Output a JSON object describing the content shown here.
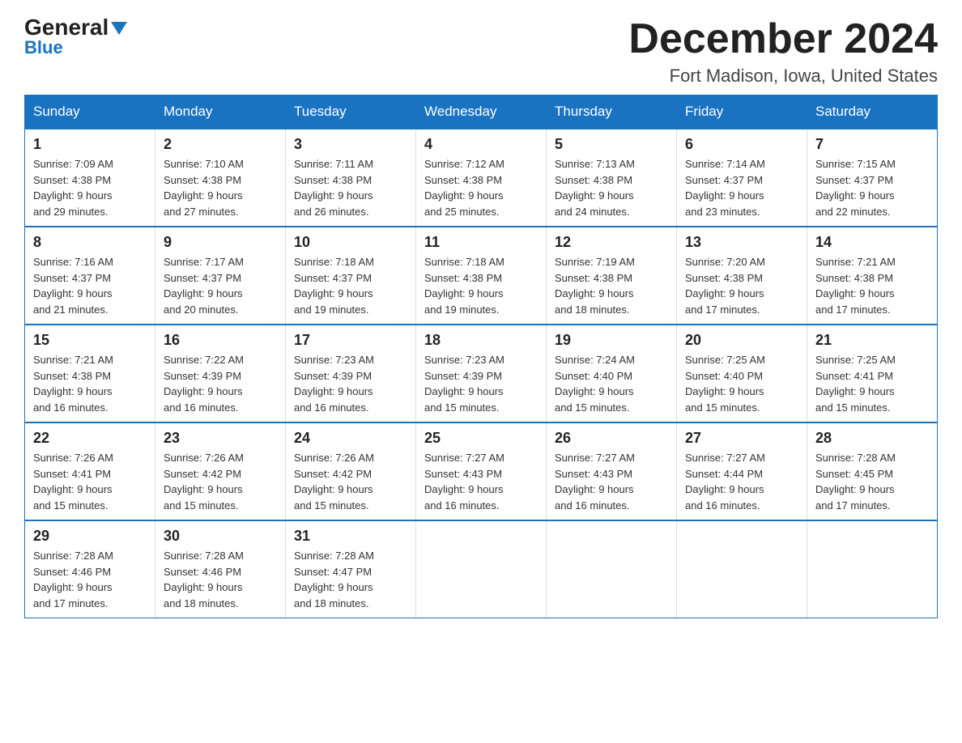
{
  "logo": {
    "general": "General",
    "blue": "Blue",
    "triangle": "▲"
  },
  "title": "December 2024",
  "location": "Fort Madison, Iowa, United States",
  "days_of_week": [
    "Sunday",
    "Monday",
    "Tuesday",
    "Wednesday",
    "Thursday",
    "Friday",
    "Saturday"
  ],
  "weeks": [
    [
      {
        "day": "1",
        "sunrise": "7:09 AM",
        "sunset": "4:38 PM",
        "daylight": "9 hours and 29 minutes."
      },
      {
        "day": "2",
        "sunrise": "7:10 AM",
        "sunset": "4:38 PM",
        "daylight": "9 hours and 27 minutes."
      },
      {
        "day": "3",
        "sunrise": "7:11 AM",
        "sunset": "4:38 PM",
        "daylight": "9 hours and 26 minutes."
      },
      {
        "day": "4",
        "sunrise": "7:12 AM",
        "sunset": "4:38 PM",
        "daylight": "9 hours and 25 minutes."
      },
      {
        "day": "5",
        "sunrise": "7:13 AM",
        "sunset": "4:38 PM",
        "daylight": "9 hours and 24 minutes."
      },
      {
        "day": "6",
        "sunrise": "7:14 AM",
        "sunset": "4:37 PM",
        "daylight": "9 hours and 23 minutes."
      },
      {
        "day": "7",
        "sunrise": "7:15 AM",
        "sunset": "4:37 PM",
        "daylight": "9 hours and 22 minutes."
      }
    ],
    [
      {
        "day": "8",
        "sunrise": "7:16 AM",
        "sunset": "4:37 PM",
        "daylight": "9 hours and 21 minutes."
      },
      {
        "day": "9",
        "sunrise": "7:17 AM",
        "sunset": "4:37 PM",
        "daylight": "9 hours and 20 minutes."
      },
      {
        "day": "10",
        "sunrise": "7:18 AM",
        "sunset": "4:37 PM",
        "daylight": "9 hours and 19 minutes."
      },
      {
        "day": "11",
        "sunrise": "7:18 AM",
        "sunset": "4:38 PM",
        "daylight": "9 hours and 19 minutes."
      },
      {
        "day": "12",
        "sunrise": "7:19 AM",
        "sunset": "4:38 PM",
        "daylight": "9 hours and 18 minutes."
      },
      {
        "day": "13",
        "sunrise": "7:20 AM",
        "sunset": "4:38 PM",
        "daylight": "9 hours and 17 minutes."
      },
      {
        "day": "14",
        "sunrise": "7:21 AM",
        "sunset": "4:38 PM",
        "daylight": "9 hours and 17 minutes."
      }
    ],
    [
      {
        "day": "15",
        "sunrise": "7:21 AM",
        "sunset": "4:38 PM",
        "daylight": "9 hours and 16 minutes."
      },
      {
        "day": "16",
        "sunrise": "7:22 AM",
        "sunset": "4:39 PM",
        "daylight": "9 hours and 16 minutes."
      },
      {
        "day": "17",
        "sunrise": "7:23 AM",
        "sunset": "4:39 PM",
        "daylight": "9 hours and 16 minutes."
      },
      {
        "day": "18",
        "sunrise": "7:23 AM",
        "sunset": "4:39 PM",
        "daylight": "9 hours and 15 minutes."
      },
      {
        "day": "19",
        "sunrise": "7:24 AM",
        "sunset": "4:40 PM",
        "daylight": "9 hours and 15 minutes."
      },
      {
        "day": "20",
        "sunrise": "7:25 AM",
        "sunset": "4:40 PM",
        "daylight": "9 hours and 15 minutes."
      },
      {
        "day": "21",
        "sunrise": "7:25 AM",
        "sunset": "4:41 PM",
        "daylight": "9 hours and 15 minutes."
      }
    ],
    [
      {
        "day": "22",
        "sunrise": "7:26 AM",
        "sunset": "4:41 PM",
        "daylight": "9 hours and 15 minutes."
      },
      {
        "day": "23",
        "sunrise": "7:26 AM",
        "sunset": "4:42 PM",
        "daylight": "9 hours and 15 minutes."
      },
      {
        "day": "24",
        "sunrise": "7:26 AM",
        "sunset": "4:42 PM",
        "daylight": "9 hours and 15 minutes."
      },
      {
        "day": "25",
        "sunrise": "7:27 AM",
        "sunset": "4:43 PM",
        "daylight": "9 hours and 16 minutes."
      },
      {
        "day": "26",
        "sunrise": "7:27 AM",
        "sunset": "4:43 PM",
        "daylight": "9 hours and 16 minutes."
      },
      {
        "day": "27",
        "sunrise": "7:27 AM",
        "sunset": "4:44 PM",
        "daylight": "9 hours and 16 minutes."
      },
      {
        "day": "28",
        "sunrise": "7:28 AM",
        "sunset": "4:45 PM",
        "daylight": "9 hours and 17 minutes."
      }
    ],
    [
      {
        "day": "29",
        "sunrise": "7:28 AM",
        "sunset": "4:46 PM",
        "daylight": "9 hours and 17 minutes."
      },
      {
        "day": "30",
        "sunrise": "7:28 AM",
        "sunset": "4:46 PM",
        "daylight": "9 hours and 18 minutes."
      },
      {
        "day": "31",
        "sunrise": "7:28 AM",
        "sunset": "4:47 PM",
        "daylight": "9 hours and 18 minutes."
      },
      null,
      null,
      null,
      null
    ]
  ],
  "labels": {
    "sunrise": "Sunrise:",
    "sunset": "Sunset:",
    "daylight": "Daylight:"
  }
}
